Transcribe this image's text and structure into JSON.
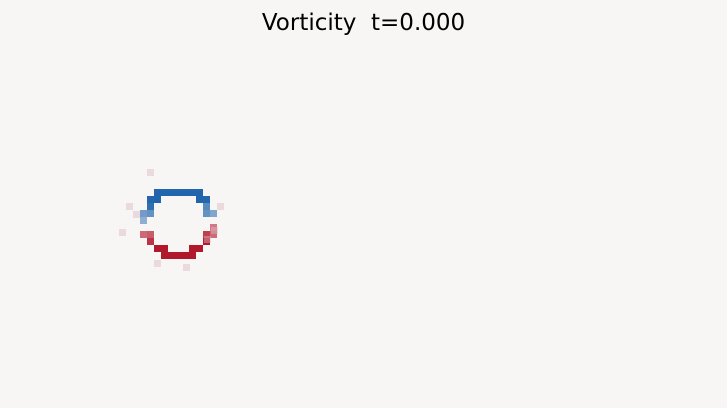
{
  "title": "Vorticity  t=0.000",
  "colors": {
    "background": "#f8f5f5",
    "negative": "#2166ac",
    "positive": "#b2182b",
    "text": "#000000"
  },
  "vorticity_field": {
    "colormap": "diverging blue-white-red",
    "ring_center_px": null
  }
}
